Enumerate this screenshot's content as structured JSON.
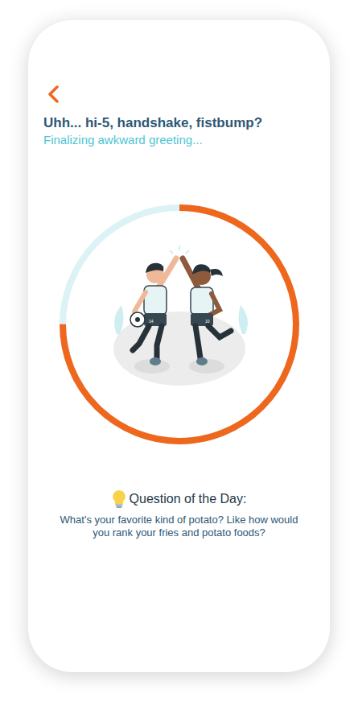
{
  "header": {
    "title": "Uhh... hi-5, handshake, fistbump?",
    "subtitle": "Finalizing awkward greeting..."
  },
  "progress": {
    "level": 0.75
  },
  "question": {
    "label": "Question of the Day:",
    "text": "What's your favorite kind of potato? Like how would you rank your fries and potato foods?"
  }
}
